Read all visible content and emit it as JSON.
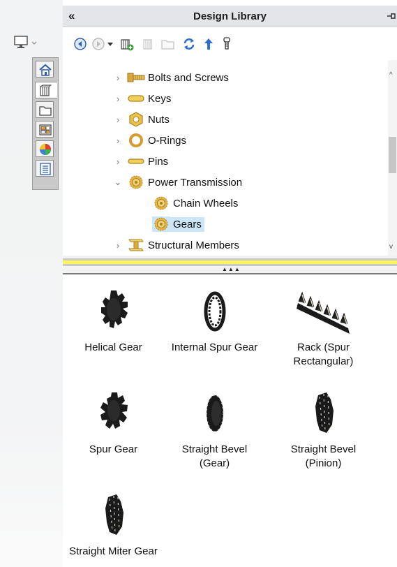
{
  "panel": {
    "collapse_glyph": "«",
    "title": "Design Library",
    "pin_icon": "pin-icon"
  },
  "side_tabs": [
    "home-icon",
    "design-library-icon",
    "file-explorer-icon",
    "view-palette-icon",
    "appearances-icon",
    "custom-properties-icon"
  ],
  "toolbar": [
    "back-icon",
    "forward-icon",
    "dropdown-arrow-icon",
    "add-to-library-icon",
    "add-file-location-icon",
    "create-new-folder-icon",
    "refresh-icon",
    "up-folder-icon",
    "toolbox-icon"
  ],
  "tree": [
    {
      "label": "Bolts and Screws",
      "icon": "bolts-icon"
    },
    {
      "label": "Keys",
      "icon": "keys-icon"
    },
    {
      "label": "Nuts",
      "icon": "nuts-icon"
    },
    {
      "label": "O-Rings",
      "icon": "orings-icon"
    },
    {
      "label": "Pins",
      "icon": "pins-icon"
    },
    {
      "label": "Power Transmission",
      "icon": "gear-folder-icon",
      "expanded": true
    },
    {
      "label": "Chain Wheels",
      "icon": "gear-folder-icon"
    },
    {
      "label": "Gears",
      "icon": "gear-folder-icon",
      "selected": true
    },
    {
      "label": "Structural Members",
      "icon": "beam-icon"
    }
  ],
  "items": [
    {
      "label": "Helical Gear",
      "icon": "helical-gear-icon"
    },
    {
      "label": "Internal Spur Gear",
      "icon": "internal-spur-gear-icon"
    },
    {
      "label": "Rack (Spur\nRectangular)",
      "icon": "rack-icon"
    },
    {
      "label": "Spur Gear",
      "icon": "spur-gear-icon"
    },
    {
      "label": "Straight Bevel\n(Gear)",
      "icon": "bevel-gear-icon"
    },
    {
      "label": "Straight Bevel\n(Pinion)",
      "icon": "bevel-pinion-icon"
    },
    {
      "label": "Straight Miter Gear",
      "icon": "miter-gear-icon"
    }
  ],
  "colors": {
    "selection": "#cde6f7",
    "splitter_accent": "#fff45a",
    "titlebar": "#e3e5e8"
  }
}
